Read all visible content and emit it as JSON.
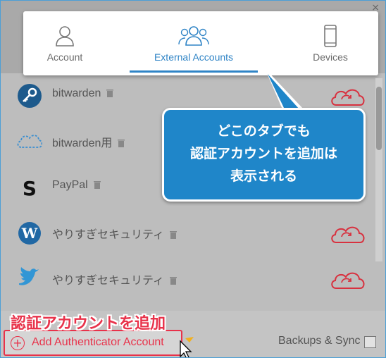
{
  "window": {
    "close_label": "×"
  },
  "tabs": [
    {
      "label": "Account",
      "icon": "person-icon",
      "active": false
    },
    {
      "label": "External Accounts",
      "icon": "people-group-icon",
      "active": true
    },
    {
      "label": "Devices",
      "icon": "phone-icon",
      "active": false
    }
  ],
  "accounts": [
    {
      "name": "bitwarden",
      "icon": "key-icon"
    },
    {
      "name": "bitwarden用",
      "icon": "cloud-dots-icon"
    },
    {
      "name": "PayPal",
      "icon": "paypal-s-icon"
    },
    {
      "name": "やりすぎセキュリティ",
      "icon": "wordpress-icon"
    },
    {
      "name": "やりすぎセキュリティ",
      "icon": "twitter-bird-icon"
    }
  ],
  "footer": {
    "add_label": "Add Authenticator Account",
    "backups_label": "Backups & Sync"
  },
  "annotations": {
    "callout_lines": [
      "どこのタブでも",
      "認証アカウントを追加は",
      "表示される"
    ],
    "add_caption": "認証アカウントを追加"
  },
  "colors": {
    "accent": "#2f84c6",
    "danger": "#e8324a",
    "callout": "#1f86c9"
  }
}
